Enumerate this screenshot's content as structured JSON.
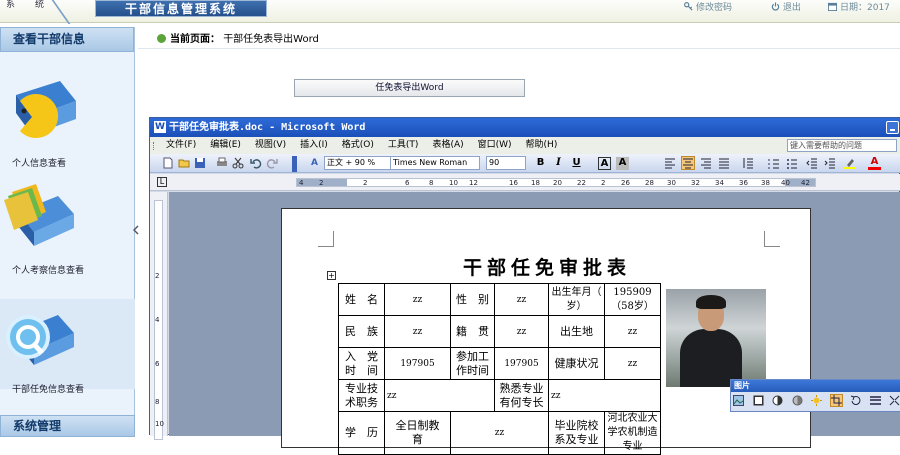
{
  "topbar": {
    "tabs": [
      "系",
      "统"
    ],
    "system_name": "干部信息管理系统",
    "change_password": "修改密码",
    "logout": "退出",
    "date_label": "日期：2017"
  },
  "sidebar": {
    "header": "查看干部信息",
    "items": [
      {
        "label": "个人信息查看"
      },
      {
        "label": "个人考察信息查看"
      },
      {
        "label": "干部任免信息查看"
      }
    ],
    "footer": "系统管理"
  },
  "breadcrumb": {
    "prefix": "当前页面：",
    "current": "干部任免表导出Word"
  },
  "export_button": "任免表导出Word",
  "word": {
    "title": "干部任免审批表.doc - Microsoft Word",
    "menus": [
      "文件(F)",
      "编辑(E)",
      "视图(V)",
      "插入(I)",
      "格式(O)",
      "工具(T)",
      "表格(A)",
      "窗口(W)",
      "帮助(H)"
    ],
    "help_placeholder": "键入需要帮助的问题",
    "style": "正文 + 90 %",
    "font": "Times New Roman",
    "size": "90",
    "ruler_ticks": [
      "4",
      "2",
      "2",
      "6",
      "8",
      "10",
      "12",
      "16",
      "18",
      "20",
      "22",
      "2",
      "26",
      "28",
      "30",
      "32",
      "34",
      "36",
      "38",
      "40",
      "42"
    ],
    "vruler_ticks": [
      "2",
      "4",
      "6",
      "8",
      "10"
    ]
  },
  "document": {
    "title": "干部任免审批表",
    "rows": [
      [
        "姓　名",
        "zz",
        "性　别",
        "zz",
        "出生年月（　岁）",
        "195909（58岁）"
      ],
      [
        "民　族",
        "zz",
        "籍　贯",
        "zz",
        "出生地",
        "zz"
      ],
      [
        "入　党时　间",
        "197905",
        "参加工作时间",
        "197905",
        "健康状况",
        "zz"
      ]
    ],
    "row4": [
      "专业技术职务",
      "zz",
      "熟悉专业有何专长",
      "zz"
    ],
    "row5": [
      "学　历",
      "全日制教　育",
      "zz",
      "毕业院校系及专业",
      "河北农业大学农机制造专业"
    ]
  },
  "picture_toolbar": {
    "title": "图片"
  }
}
